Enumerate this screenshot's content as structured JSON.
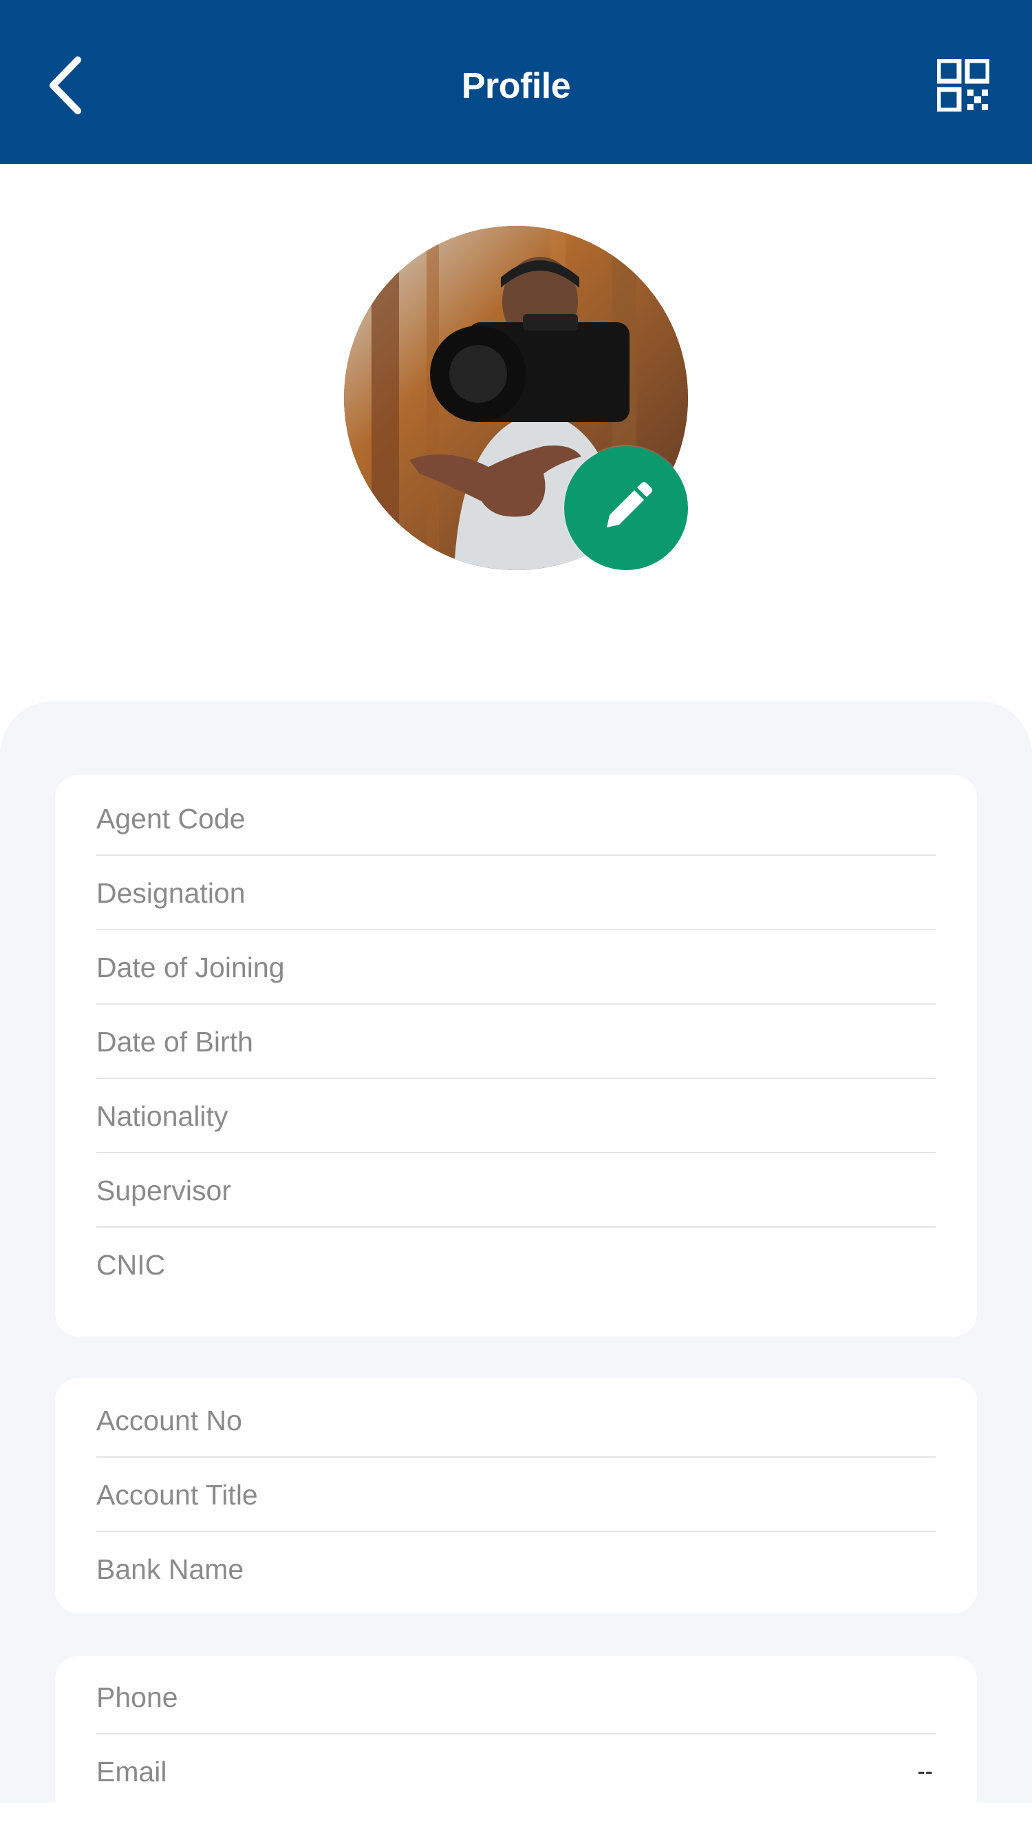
{
  "header": {
    "title": "Profile",
    "background": "#024a8a",
    "back_icon": "chevron-left-icon",
    "qr_icon": "qr-code-icon"
  },
  "avatar": {
    "edit_icon": "pencil-icon",
    "edit_color": "#0b9a6e"
  },
  "personal_info": [
    {
      "label": "Agent Code",
      "value": ""
    },
    {
      "label": "Designation",
      "value": ""
    },
    {
      "label": "Date of Joining",
      "value": ""
    },
    {
      "label": "Date of Birth",
      "value": ""
    },
    {
      "label": "Nationality",
      "value": ""
    },
    {
      "label": "Supervisor",
      "value": ""
    },
    {
      "label": "CNIC",
      "value": ""
    }
  ],
  "bank_info": [
    {
      "label": "Account No",
      "value": ""
    },
    {
      "label": "Account Title",
      "value": ""
    },
    {
      "label": "Bank Name",
      "value": ""
    }
  ],
  "contact_info": [
    {
      "label": "Phone",
      "value": ""
    },
    {
      "label": "Email",
      "value": "--"
    }
  ]
}
